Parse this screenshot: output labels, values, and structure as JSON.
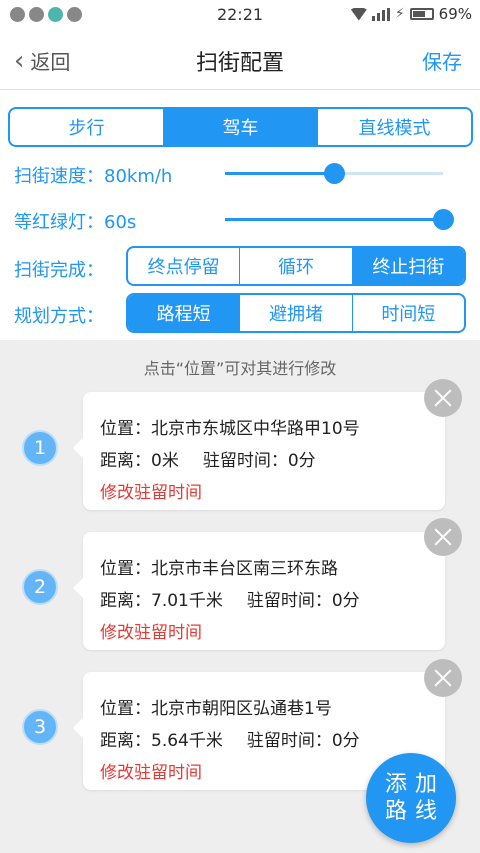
{
  "status": {
    "time": "22:21",
    "battery": "69%"
  },
  "nav": {
    "back_label": "返回",
    "title": "扫街配置",
    "save_label": "保存"
  },
  "mode": {
    "options": [
      "步行",
      "驾车",
      "直线模式"
    ],
    "selected": "驾车"
  },
  "speed": {
    "label": "扫街速度：80km/h",
    "level": 0.5
  },
  "light": {
    "label": "等红绿灯：60s",
    "level": 1.0
  },
  "finish": {
    "label": "扫街完成：",
    "options": [
      "终点停留",
      "循环",
      "终止扫街"
    ],
    "selected": "终止扫街"
  },
  "plan": {
    "label": "规划方式：",
    "options": [
      "路程短",
      "避拥堵",
      "时间短"
    ],
    "selected": "路程短"
  },
  "hint": "点击“位置”可对其进行修改",
  "stops": [
    {
      "num": "1",
      "location": "位置：北京市东城区中华路甲10号",
      "distance": "距离：0米",
      "stay": "驻留时间：0分",
      "action": "修改驻留时间"
    },
    {
      "num": "2",
      "location": "位置：北京市丰台区南三环东路",
      "distance": "距离：7.01千米",
      "stay": "驻留时间：0分",
      "action": "修改驻留时间"
    },
    {
      "num": "3",
      "location": "位置：北京市朝阳区弘通巷1号",
      "distance": "距离：5.64千米",
      "stay": "驻留时间：0分",
      "action": "修改驻留时间"
    }
  ],
  "fab": {
    "line1": "添加",
    "line2": "路线"
  }
}
